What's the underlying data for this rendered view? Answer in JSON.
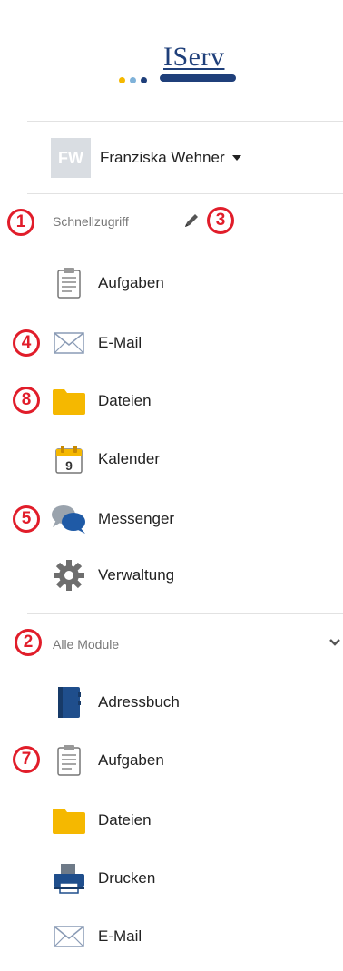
{
  "brand": {
    "name": "IServ",
    "dot_colors": [
      "#f5b800",
      "#7fb2d9",
      "#1f3f7a"
    ]
  },
  "user": {
    "initials": "FW",
    "name": "Franziska Wehner"
  },
  "quick_access": {
    "title": "Schnellzugriff",
    "items": [
      {
        "label": "Aufgaben",
        "icon": "clipboard-icon"
      },
      {
        "label": "E-Mail",
        "icon": "envelope-icon"
      },
      {
        "label": "Dateien",
        "icon": "folder-icon"
      },
      {
        "label": "Kalender",
        "icon": "calendar-icon",
        "icon_text": "9"
      },
      {
        "label": "Messenger",
        "icon": "chat-bubbles-icon"
      },
      {
        "label": "Verwaltung",
        "icon": "gear-icon"
      }
    ]
  },
  "all_modules": {
    "title": "Alle Module",
    "items": [
      {
        "label": "Adressbuch",
        "icon": "address-book-icon"
      },
      {
        "label": "Aufgaben",
        "icon": "clipboard-icon"
      },
      {
        "label": "Dateien",
        "icon": "folder-icon"
      },
      {
        "label": "Drucken",
        "icon": "printer-icon"
      },
      {
        "label": "E-Mail",
        "icon": "envelope-icon"
      }
    ]
  },
  "annotations": [
    "1",
    "2",
    "3",
    "4",
    "5",
    "7",
    "8"
  ],
  "colors": {
    "annotation": "#e11d2a",
    "brand": "#1f3f7a",
    "folder": "#f5b800",
    "chat": "#1f5aa6"
  }
}
